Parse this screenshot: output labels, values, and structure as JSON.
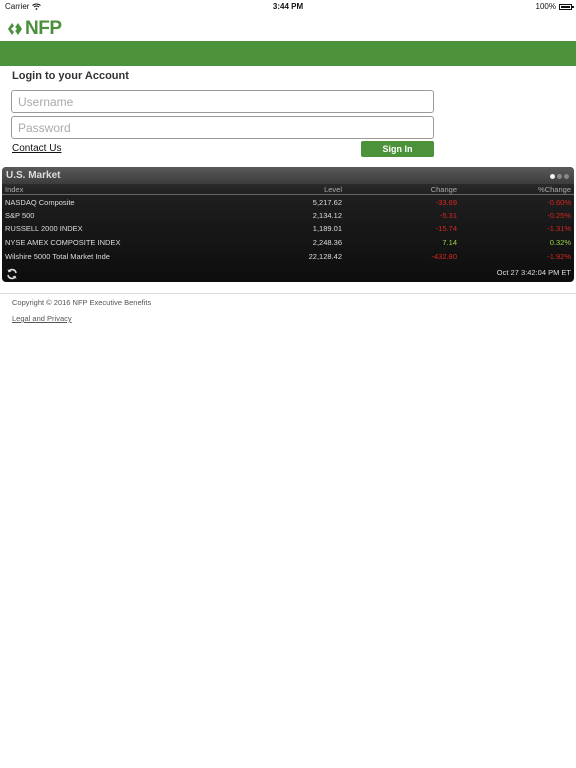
{
  "status_bar": {
    "carrier": "Carrier",
    "time": "3:44 PM",
    "battery": "100%"
  },
  "brand": {
    "logo_text": "NFP",
    "color": "#4b923a"
  },
  "login": {
    "title": "Login to your Account",
    "username_placeholder": "Username",
    "password_placeholder": "Password",
    "contact_label": "Contact Us",
    "signin_label": "Sign In"
  },
  "market": {
    "title": "U.S. Market",
    "columns": {
      "index": "Index",
      "level": "Level",
      "change": "Change",
      "pct": "%Change"
    },
    "rows": [
      {
        "index": "NASDAQ Composite",
        "level": "5,217.62",
        "change": "-33.69",
        "pct": "-0.60%",
        "direction": "neg"
      },
      {
        "index": "S&P 500",
        "level": "2,134.12",
        "change": "-5.31",
        "pct": "-0.25%",
        "direction": "neg"
      },
      {
        "index": "RUSSELL 2000 INDEX",
        "level": "1,189.01",
        "change": "-15.74",
        "pct": "-1.31%",
        "direction": "neg"
      },
      {
        "index": "NYSE AMEX COMPOSITE INDEX",
        "level": "2,248.36",
        "change": "7.14",
        "pct": "0.32%",
        "direction": "pos"
      },
      {
        "index": "Wilshire 5000 Total Market Inde",
        "level": "22,128.42",
        "change": "-432.80",
        "pct": "-1.92%",
        "direction": "neg"
      }
    ],
    "timestamp": "Oct 27 3:42:04 PM ET",
    "page_dots": 3,
    "active_dot": 0,
    "colors": {
      "negative": "#d7261f",
      "positive": "#9bd34a"
    }
  },
  "footer": {
    "copyright": "Copyright © 2016 NFP Executive Benefits",
    "legal_label": "Legal and Privacy"
  }
}
